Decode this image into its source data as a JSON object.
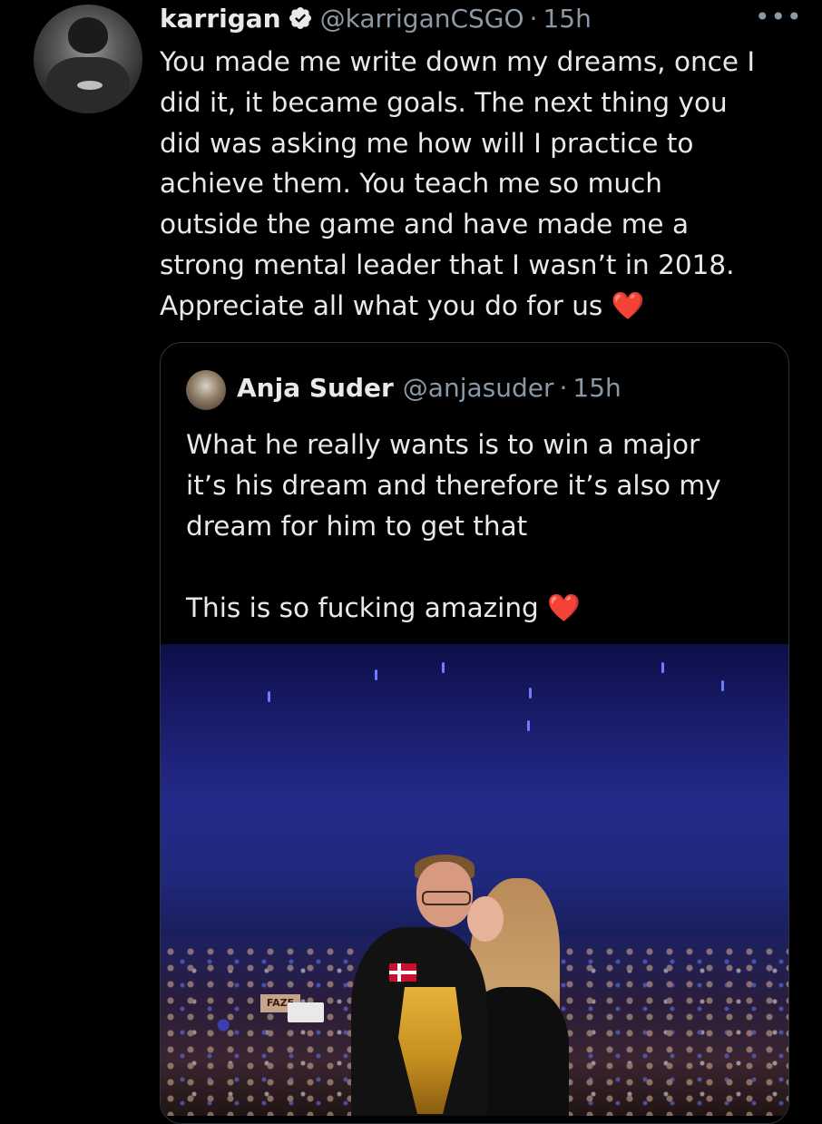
{
  "tweet": {
    "author_name": "karrigan",
    "handle": "@karriganCSGO",
    "separator": "·",
    "time": "15h",
    "more_label": "•••",
    "text": "You made me write down my dreams, once I\ndid it, it became goals. The next thing you\ndid was asking me how will I practice to\nachieve them. You teach me so much\noutside the game and have made me a\nstrong mental leader that I wasn’t in 2018.\nAppreciate all what you do for us ",
    "heart": "❤️"
  },
  "quoted": {
    "author_name": "Anja Suder",
    "handle": "@anjasuder",
    "separator": "·",
    "time": "15h",
    "text": "What he really wants is to win a major\nit’s his dream and therefore it’s also my\ndream for him to get that\n\nThis is so fucking amazing ",
    "heart": "❤️"
  },
  "photo": {
    "crowd_sign": "FAZE"
  },
  "colors": {
    "background": "#000000",
    "text_primary": "#e7e9ea",
    "text_secondary": "#8b98a5",
    "verified_badge": "#e7e9ea",
    "border": "#2f3336"
  }
}
